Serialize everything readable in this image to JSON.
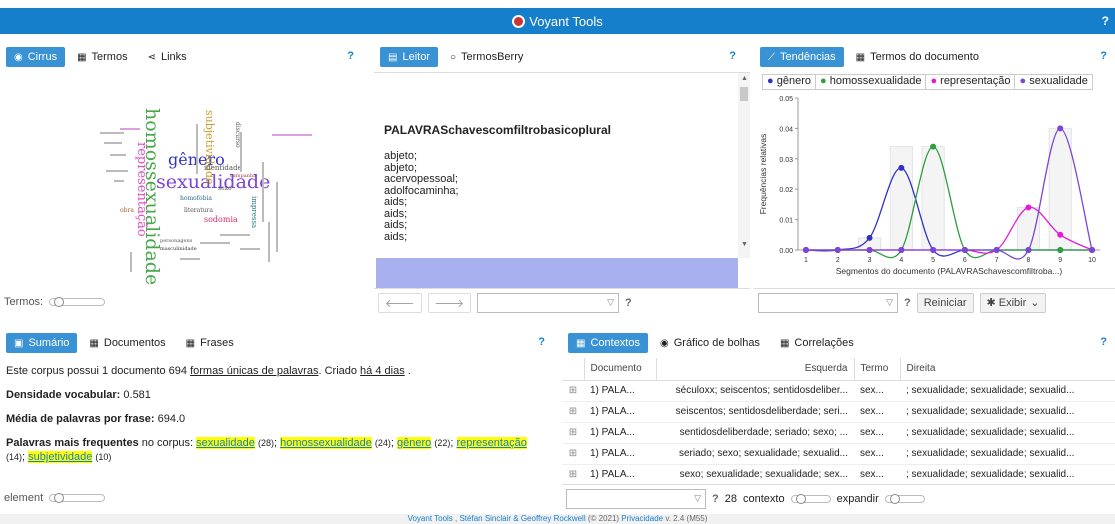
{
  "app": {
    "title": "Voyant Tools",
    "help": "?"
  },
  "cirrus": {
    "tabs": [
      {
        "label": "Cirrus",
        "active": true,
        "icon": "eye-icon"
      },
      {
        "label": "Termos",
        "active": false,
        "icon": "table-icon"
      },
      {
        "label": "Links",
        "active": false,
        "icon": "share-icon"
      }
    ],
    "help": "?",
    "words": [
      "homossexualidade",
      "sexualidade",
      "gênero",
      "representação",
      "subjetividade",
      "identidade",
      "homofobia",
      "literatura",
      "sodomia",
      "discurso",
      "impressa",
      "campanha",
      "personagens",
      "masculinidade",
      "sexo",
      "obra"
    ],
    "slider_label": "Termos:"
  },
  "reader": {
    "tabs": [
      {
        "label": "Leitor",
        "active": true,
        "icon": "doc-icon"
      },
      {
        "label": "TermosBerry",
        "active": false,
        "icon": "circle-icon"
      }
    ],
    "help": "?",
    "doc_title": "PALAVRASchavescomfiltrobasicoplural",
    "lines": [
      "abjeto;",
      "abjeto;",
      "acervopessoal;",
      "adolfocaminha;",
      "aids;",
      "aids;",
      "aids;",
      "aids;"
    ],
    "help2": "?"
  },
  "trends": {
    "tabs": [
      {
        "label": "Tendências",
        "active": true,
        "icon": "trend-icon"
      },
      {
        "label": "Termos do documento",
        "active": false,
        "icon": "table-icon"
      }
    ],
    "help": "?",
    "legend": [
      {
        "name": "gênero",
        "color": "#3131c6"
      },
      {
        "name": "homossexualidade",
        "color": "#2e9e3f"
      },
      {
        "name": "representação",
        "color": "#e21dd7"
      },
      {
        "name": "sexualidade",
        "color": "#7b45d6"
      }
    ],
    "chart_data": {
      "type": "line",
      "x": [
        1,
        2,
        3,
        4,
        5,
        6,
        7,
        8,
        9,
        10
      ],
      "series": [
        {
          "name": "gênero",
          "values": [
            0,
            0,
            0.004,
            0.027,
            0,
            0,
            0,
            0,
            0,
            0
          ]
        },
        {
          "name": "homossexualidade",
          "values": [
            0,
            0,
            0,
            0,
            0.034,
            0,
            0,
            0,
            0,
            0
          ]
        },
        {
          "name": "representação",
          "values": [
            0,
            0,
            0,
            0,
            0,
            0,
            0,
            0.014,
            0.005,
            0
          ]
        },
        {
          "name": "sexualidade",
          "values": [
            0,
            0,
            0,
            0,
            0,
            0,
            0,
            0,
            0.04,
            0
          ]
        }
      ],
      "bars": [
        0,
        0,
        0.004,
        0.034,
        0.034,
        0,
        0,
        0.014,
        0.04,
        0
      ],
      "ylabel": "Frequências relativas",
      "xlabel": "Segmentos do documento (PALAVRASchavescomfiltroba...)",
      "ylim": [
        0,
        0.05
      ],
      "yticks": [
        "0.05",
        "0.04",
        "0.03",
        "0.02",
        "0.01",
        "0.00"
      ],
      "xticks": [
        "1",
        "2",
        "3",
        "4",
        "5",
        "6",
        "7",
        "8",
        "9",
        "10"
      ]
    },
    "reset_label": "Reiniciar",
    "show_label": "Exibir",
    "help2": "?"
  },
  "summary": {
    "tabs": [
      {
        "label": "Sumário",
        "active": true,
        "icon": "summary-icon"
      },
      {
        "label": "Documentos",
        "active": false,
        "icon": "table-icon"
      },
      {
        "label": "Frases",
        "active": false,
        "icon": "table-icon"
      }
    ],
    "help": "?",
    "line1_a": "Este corpus possui 1 documento 694 ",
    "line1_link": "formas únicas de palavras",
    "line1_b": ". Criado ",
    "line1_link2": "há 4 dias",
    "line1_c": " .",
    "density_label": "Densidade vocabular:",
    "density_value": "0.581",
    "avg_label": "Média de palavras por frase:",
    "avg_value": "694.0",
    "freq_label": "Palavras mais frequentes",
    "freq_mid": " no corpus:",
    "freq_words": [
      {
        "w": "sexualidade",
        "n": "(28)"
      },
      {
        "w": "homossexualidade",
        "n": "(24)"
      },
      {
        "w": "gênero",
        "n": "(22)"
      },
      {
        "w": "representação",
        "n": "(14)"
      },
      {
        "w": "subjetividade",
        "n": "(10)"
      }
    ],
    "slider_label": "element"
  },
  "contexts": {
    "tabs": [
      {
        "label": "Contextos",
        "active": true,
        "icon": "table-icon"
      },
      {
        "label": "Gráfico de bolhas",
        "active": false,
        "icon": "eye-icon"
      },
      {
        "label": "Correlações",
        "active": false,
        "icon": "table-icon"
      }
    ],
    "help": "?",
    "columns": [
      "Documento",
      "Esquerda",
      "Termo",
      "Direita"
    ],
    "rows": [
      [
        "1) PALA...",
        "séculoxx; seiscentos; sentidosdeliber...",
        "sex...",
        "; sexualidade; sexualidade; sexualid..."
      ],
      [
        "1) PALA...",
        "seiscentos; sentidosdeliberdade; seri...",
        "sex...",
        "; sexualidade; sexualidade; sexualid..."
      ],
      [
        "1) PALA...",
        "sentidosdeliberdade; seriado; sexo; ...",
        "sex...",
        "; sexualidade; sexualidade; sexualid..."
      ],
      [
        "1) PALA...",
        "seriado; sexo; sexualidade; sexualid...",
        "sex...",
        "; sexualidade; sexualidade; sexualid..."
      ],
      [
        "1) PALA...",
        "sexo; sexualidade; sexualidade; sex...",
        "sex...",
        "; sexualidade; sexualidade; sexualid..."
      ]
    ],
    "count": "28",
    "context_label": "contexto",
    "expand_label": "expandir",
    "help2": "?"
  },
  "footer": {
    "a": "Voyant Tools",
    "b": " , ",
    "c": "Stéfan Sinclair & Geoffrey Rockwell",
    "d": " (© 2021) ",
    "e": "Privacidade",
    "f": " v. 2.4 (M55)"
  }
}
